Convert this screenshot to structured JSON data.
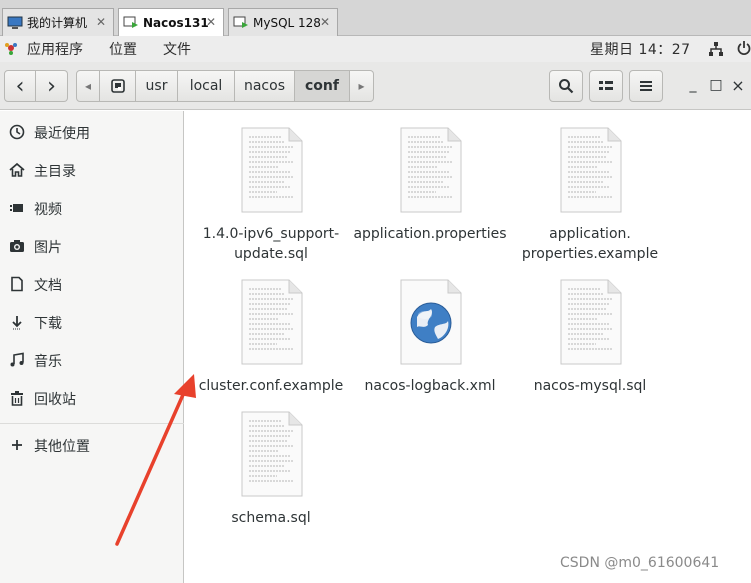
{
  "vm_tabs": [
    {
      "label": "我的计算机",
      "icon": "computer-icon"
    },
    {
      "label": "Nacos131",
      "icon": "vm-running-icon"
    },
    {
      "label": "MySQL 128",
      "icon": "vm-running-icon"
    }
  ],
  "topbar": {
    "applications": "应用程序",
    "places": "位置",
    "files": "文件",
    "clock": "星期日 14：27"
  },
  "toolbar": {
    "back": "‹",
    "forward": "›",
    "crumb_left": "◂",
    "crumb_right": "▸",
    "breadcrumb": [
      "usr",
      "local",
      "nacos",
      "conf"
    ],
    "minimize": "_",
    "maximize": "□",
    "close": "×"
  },
  "sidebar": {
    "items": [
      {
        "label": "最近使用",
        "icon": "clock-icon"
      },
      {
        "label": "主目录",
        "icon": "home-icon"
      },
      {
        "label": "视频",
        "icon": "video-icon"
      },
      {
        "label": "图片",
        "icon": "camera-icon"
      },
      {
        "label": "文档",
        "icon": "document-icon"
      },
      {
        "label": "下载",
        "icon": "download-icon"
      },
      {
        "label": "音乐",
        "icon": "music-icon"
      },
      {
        "label": "回收站",
        "icon": "trash-icon"
      },
      {
        "label": "其他位置",
        "icon": "plus-icon"
      }
    ]
  },
  "files": [
    {
      "line1": "1.4.0-ipv6_support-",
      "line2": "update.sql",
      "icon": "text-file-icon"
    },
    {
      "line1": "application.properties",
      "line2": "",
      "icon": "text-file-icon"
    },
    {
      "line1": "application.",
      "line2": "properties.example",
      "icon": "text-file-icon"
    },
    {
      "line1": "cluster.conf.example",
      "line2": "",
      "icon": "text-file-icon"
    },
    {
      "line1": "nacos-logback.xml",
      "line2": "",
      "icon": "xml-globe-file-icon"
    },
    {
      "line1": "nacos-mysql.sql",
      "line2": "",
      "icon": "text-file-icon"
    },
    {
      "line1": "schema.sql",
      "line2": "",
      "icon": "text-file-icon"
    }
  ],
  "watermark": "CSDN @m0_61600641",
  "colors": {
    "annotation_arrow": "#e8412c",
    "globe_blue": "#3f7fc5"
  }
}
